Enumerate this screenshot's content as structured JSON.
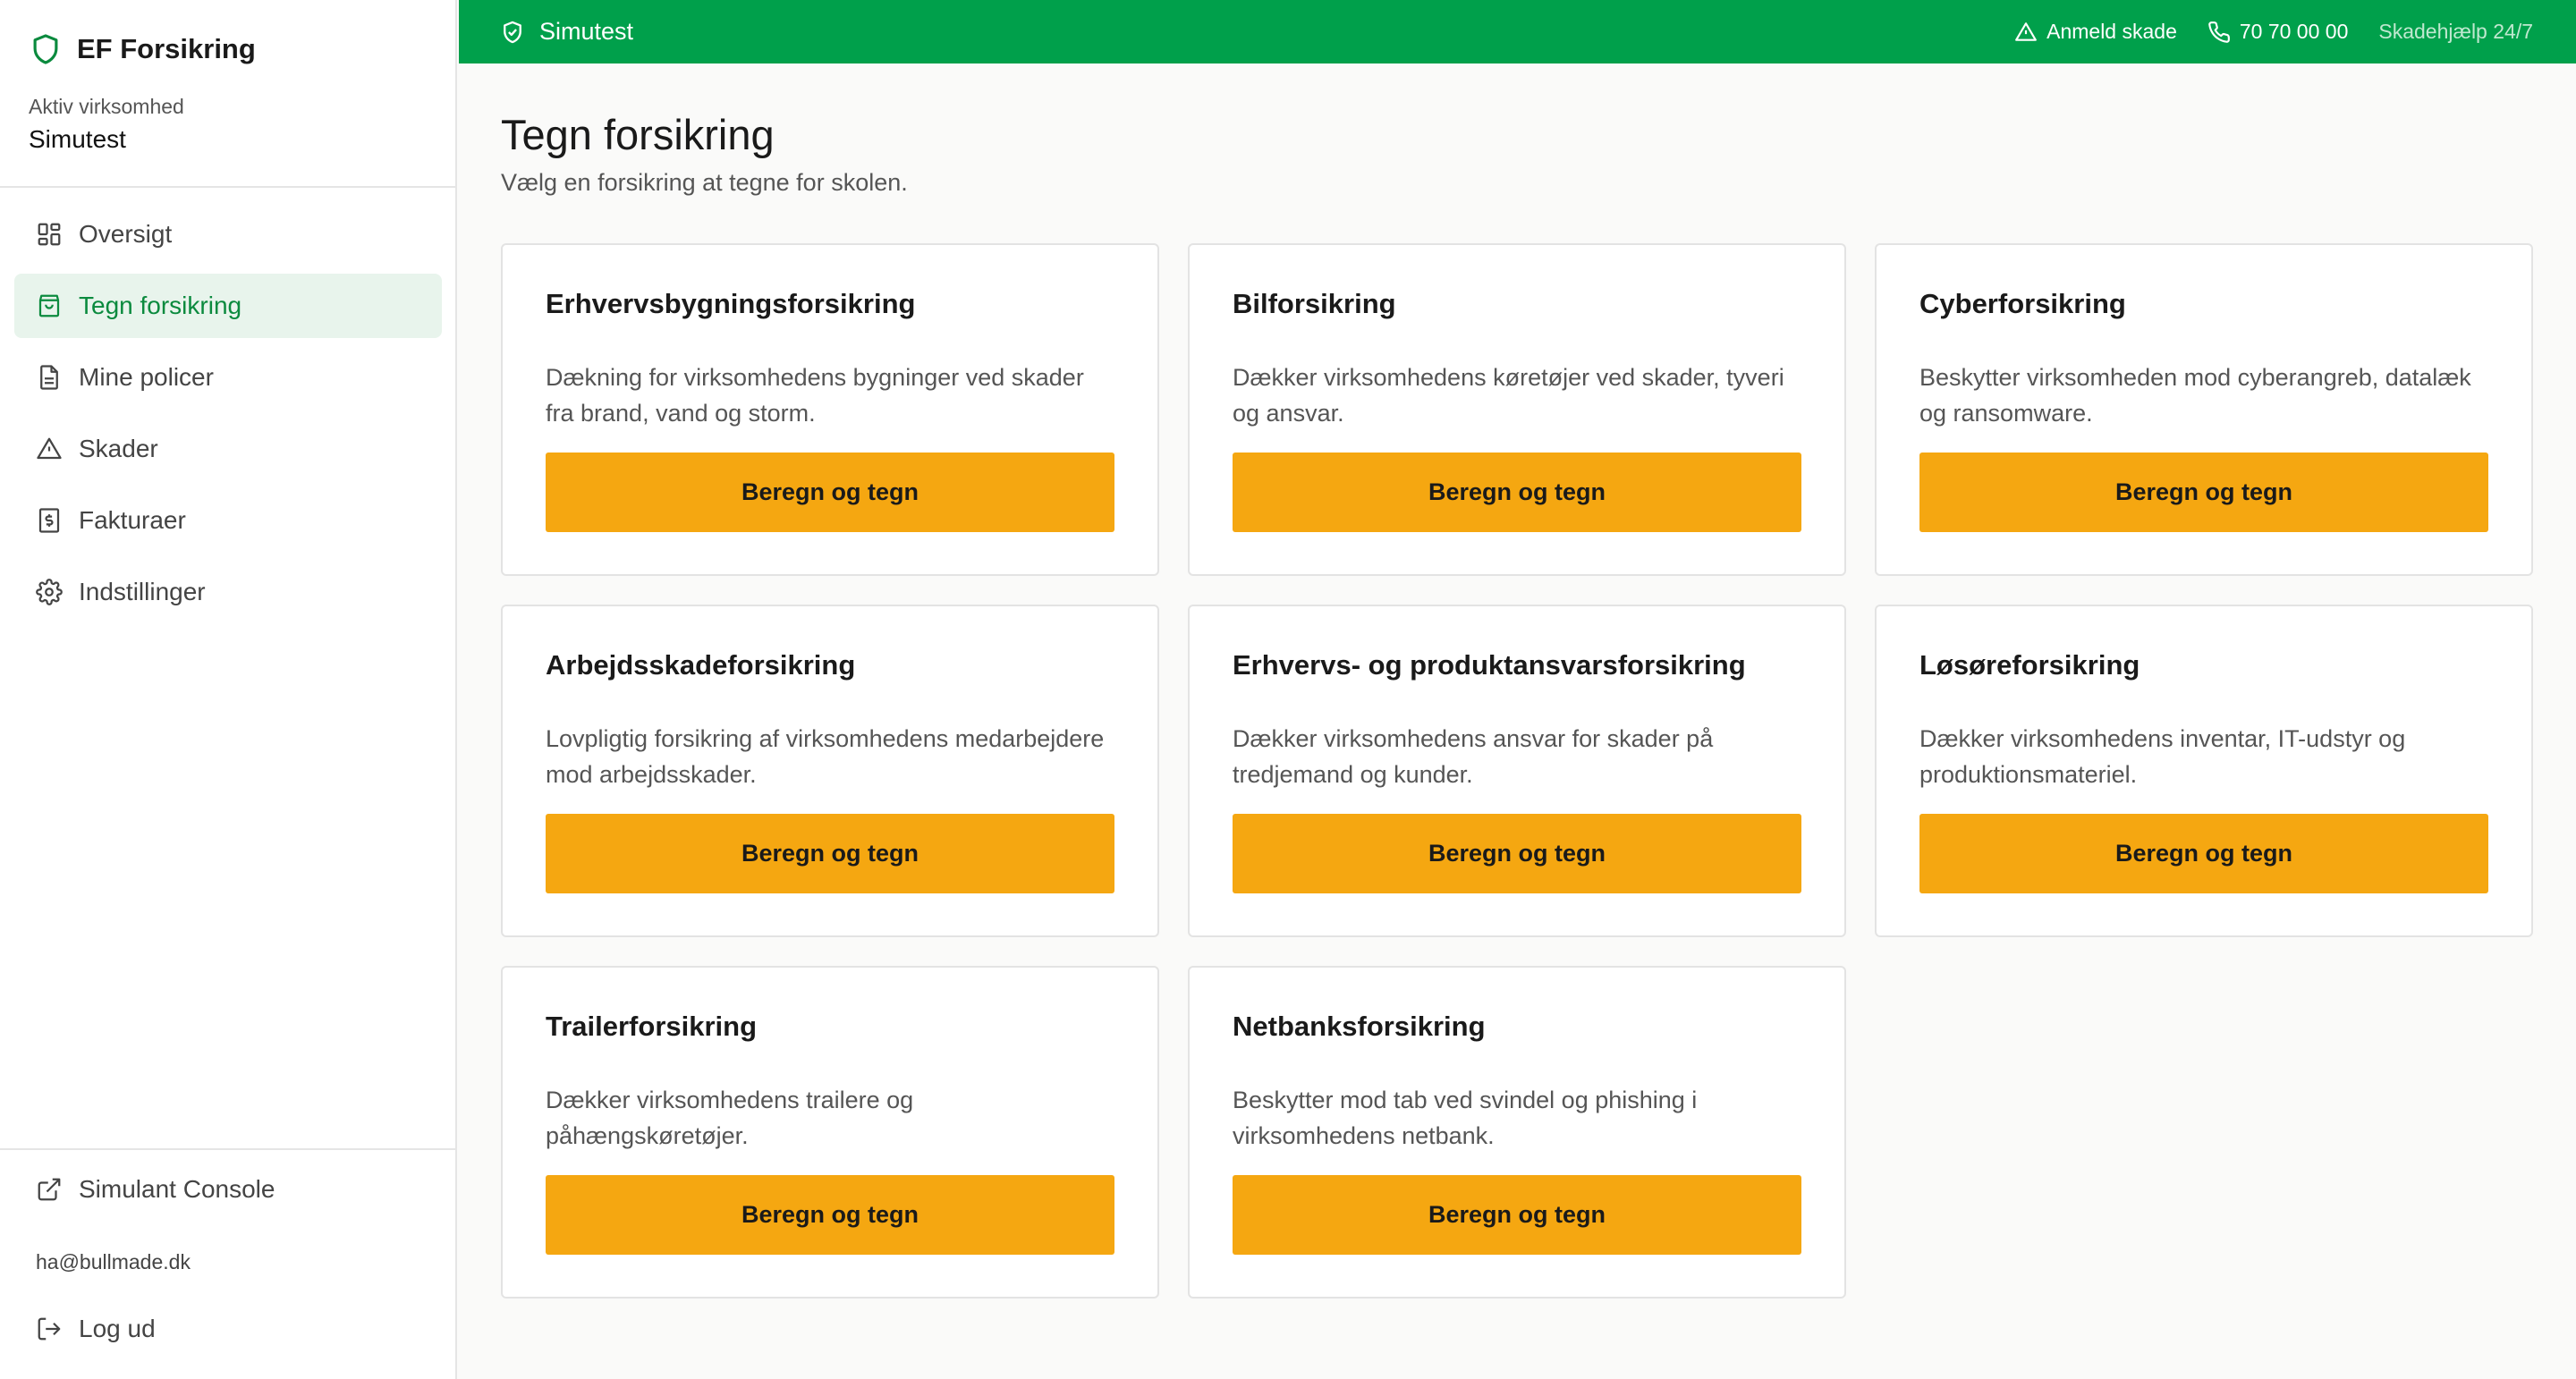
{
  "app": {
    "name": "EF Forsikring"
  },
  "company": {
    "label": "Aktiv virksomhed",
    "name": "Simutest"
  },
  "nav": [
    {
      "label": "Oversigt",
      "icon": "dashboard-icon",
      "active": false
    },
    {
      "label": "Tegn forsikring",
      "icon": "shopping-bag-icon",
      "active": true
    },
    {
      "label": "Mine policer",
      "icon": "document-icon",
      "active": false
    },
    {
      "label": "Skader",
      "icon": "warning-icon",
      "active": false
    },
    {
      "label": "Fakturaer",
      "icon": "invoice-icon",
      "active": false
    },
    {
      "label": "Indstillinger",
      "icon": "gear-icon",
      "active": false
    }
  ],
  "sidebar_bottom": {
    "console_label": "Simulant Console",
    "user_email": "ha@bullmade.dk",
    "logout_label": "Log ud"
  },
  "topbar": {
    "company": "Simutest",
    "report_label": "Anmeld skade",
    "phone": "70 70 00 00",
    "help_label": "Skadehjælp 24/7"
  },
  "page": {
    "title": "Tegn forsikring",
    "subtitle": "Vælg en forsikring at tegne for skolen."
  },
  "cards": [
    {
      "title": "Erhvervsbygningsforsikring",
      "description": "Dækning for virksomhedens bygninger ved skader fra brand, vand og storm.",
      "button": "Beregn og tegn"
    },
    {
      "title": "Bilforsikring",
      "description": "Dækker virksomhedens køretøjer ved skader, tyveri og ansvar.",
      "button": "Beregn og tegn"
    },
    {
      "title": "Cyberforsikring",
      "description": "Beskytter virksomheden mod cyberangreb, datalæk og ransomware.",
      "button": "Beregn og tegn"
    },
    {
      "title": "Arbejdsskadeforsikring",
      "description": "Lovpligtig forsikring af virksomhedens medarbejdere mod arbejdsskader.",
      "button": "Beregn og tegn"
    },
    {
      "title": "Erhvervs- og produktansvarsforsikring",
      "description": "Dækker virksomhedens ansvar for skader på tredjemand og kunder.",
      "button": "Beregn og tegn"
    },
    {
      "title": "Løsøreforsikring",
      "description": "Dækker virksomhedens inventar, IT-udstyr og produktionsmateriel.",
      "button": "Beregn og tegn"
    },
    {
      "title": "Trailerforsikring",
      "description": "Dækker virksomhedens trailere og påhængskøretøjer.",
      "button": "Beregn og tegn"
    },
    {
      "title": "Netbanksforsikring",
      "description": "Beskytter mod tab ved svindel og phishing i virksomhedens netbank.",
      "button": "Beregn og tegn"
    }
  ],
  "colors": {
    "brand_green": "#00a04b",
    "active_nav_bg": "#e8f4ec",
    "active_nav_text": "#0b8a3e",
    "cta_orange": "#f5a711"
  }
}
